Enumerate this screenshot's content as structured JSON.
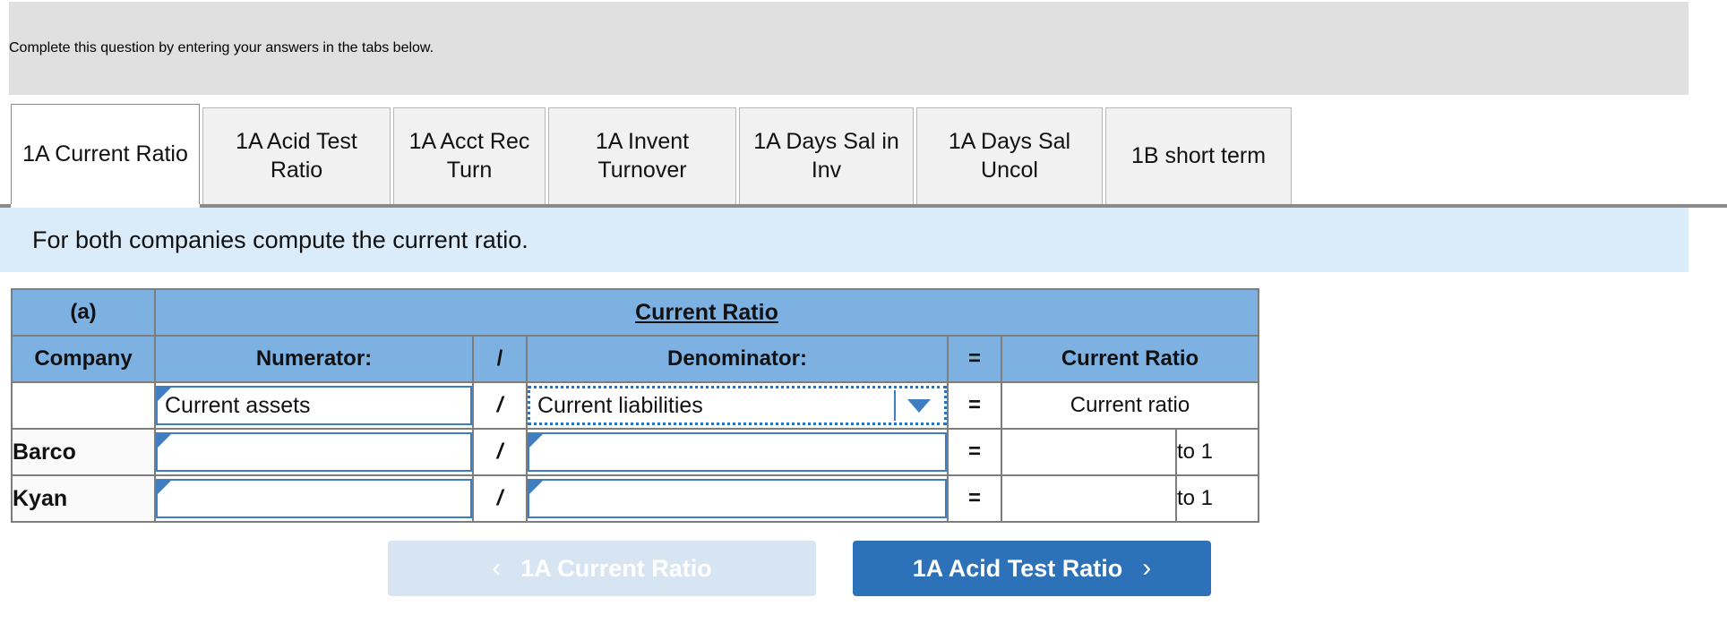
{
  "banner": {
    "text": "Complete this question by entering your answers in the tabs below."
  },
  "tabs": [
    {
      "label": "1A Current Ratio",
      "active": true
    },
    {
      "label": "1A Acid Test Ratio",
      "active": false
    },
    {
      "label": "1A Acct Rec Turn",
      "active": false
    },
    {
      "label": "1A Invent Turnover",
      "active": false
    },
    {
      "label": "1A Days Sal in Inv",
      "active": false
    },
    {
      "label": "1A Days Sal Uncol",
      "active": false
    },
    {
      "label": "1B short term",
      "active": false
    }
  ],
  "instruction": {
    "text": "For both companies compute the current ratio."
  },
  "table": {
    "group_label": "(a)",
    "title": "Current Ratio",
    "headers": {
      "company": "Company",
      "numerator": "Numerator:",
      "slash": "/",
      "denominator": "Denominator:",
      "equals": "=",
      "result": "Current Ratio"
    },
    "rows": [
      {
        "company": "",
        "numerator_value": "Current assets",
        "slash": "/",
        "denominator_value": "Current liabilities",
        "equals": "=",
        "result": "Current ratio",
        "suffix": ""
      },
      {
        "company": "Barco",
        "numerator_value": "",
        "slash": "/",
        "denominator_value": "",
        "equals": "=",
        "result": "",
        "suffix": "to 1"
      },
      {
        "company": "Kyan",
        "numerator_value": "",
        "slash": "/",
        "denominator_value": "",
        "equals": "=",
        "result": "",
        "suffix": "to 1"
      }
    ]
  },
  "nav": {
    "prev_label": "1A Current Ratio",
    "prev_chevron": "‹",
    "next_label": "1A Acid Test Ratio",
    "next_chevron": "›"
  },
  "colors": {
    "banner_bg": "#e0e0e0",
    "instruction_bg": "#daecf9",
    "table_header_bg": "#7cb1e2",
    "field_border": "#3f7fc1",
    "next_button_bg": "#2d72b8",
    "prev_button_bg": "#d7e5f3"
  }
}
